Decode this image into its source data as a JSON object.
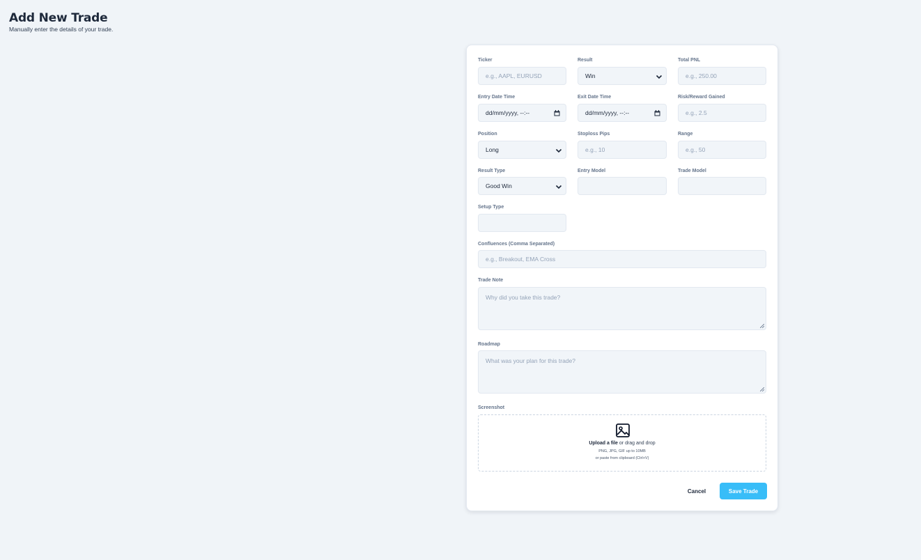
{
  "header": {
    "title": "Add New Trade",
    "subtitle": "Manually enter the details of your trade."
  },
  "form": {
    "ticker": {
      "label": "Ticker",
      "placeholder": "e.g., AAPL, EURUSD"
    },
    "result": {
      "label": "Result",
      "value": "Win"
    },
    "total_pnl": {
      "label": "Total PNL",
      "placeholder": "e.g., 250.00"
    },
    "entry_datetime": {
      "label": "Entry Date Time",
      "value": "dd/mm/yyyy, --:--"
    },
    "exit_datetime": {
      "label": "Exit Date Time",
      "value": "dd/mm/yyyy, --:--"
    },
    "risk_reward": {
      "label": "Risk/Reward Gained",
      "placeholder": "e.g., 2.5"
    },
    "position": {
      "label": "Position",
      "value": "Long"
    },
    "stoploss_pips": {
      "label": "Stoploss Pips",
      "placeholder": "e.g., 10"
    },
    "range": {
      "label": "Range",
      "placeholder": "e.g., 50"
    },
    "result_type": {
      "label": "Result Type",
      "value": "Good Win"
    },
    "entry_model": {
      "label": "Entry Model",
      "value": ""
    },
    "trade_model": {
      "label": "Trade Model",
      "value": ""
    },
    "setup_type": {
      "label": "Setup Type",
      "value": ""
    },
    "confluences": {
      "label": "Confluences (Comma Separated)",
      "placeholder": "e.g., Breakout, EMA Cross"
    },
    "trade_note": {
      "label": "Trade Note",
      "placeholder": "Why did you take this trade?"
    },
    "roadmap": {
      "label": "Roadmap",
      "placeholder": "What was your plan for this trade?"
    },
    "screenshot": {
      "label": "Screenshot",
      "upload_link": "Upload a file",
      "upload_rest": " or drag and drop",
      "formats": "PNG, JPG, GIF up to 10MB",
      "paste_hint": "or paste from clipboard (Ctrl+V)",
      "icon": "image-icon"
    }
  },
  "actions": {
    "cancel_label": "Cancel",
    "save_label": "Save Trade"
  },
  "colors": {
    "accent": "#38bdf8",
    "background": "#f0f4f8",
    "field_background": "#f1f5f9"
  }
}
